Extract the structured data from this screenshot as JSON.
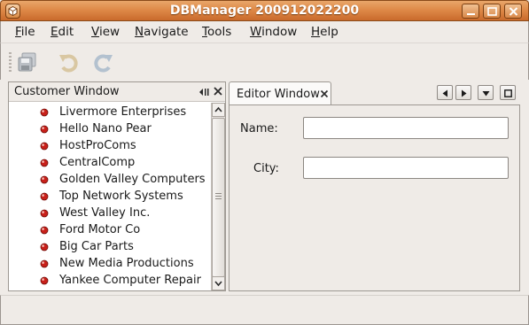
{
  "window": {
    "title": "DBManager 200912022200",
    "controls": [
      "minimize-icon",
      "maximize-icon",
      "close-icon"
    ]
  },
  "menubar": {
    "items": [
      {
        "label": "File",
        "mnemonic": "F"
      },
      {
        "label": "Edit",
        "mnemonic": "E"
      },
      {
        "label": "View",
        "mnemonic": "V"
      },
      {
        "label": "Navigate",
        "mnemonic": "N"
      },
      {
        "label": "Tools",
        "mnemonic": "T"
      },
      {
        "label": "Window",
        "mnemonic": "W"
      },
      {
        "label": "Help",
        "mnemonic": "H"
      }
    ]
  },
  "toolbar": {
    "buttons": [
      {
        "icon": "save-all-icon",
        "enabled": false
      },
      {
        "icon": "undo-icon",
        "enabled": false
      },
      {
        "icon": "redo-icon",
        "enabled": false
      }
    ]
  },
  "customer_window": {
    "title": "Customer Window",
    "customers": [
      "Livermore Enterprises",
      "Hello Nano Pear",
      "HostProComs",
      "CentralComp",
      "Golden Valley Computers",
      "Top Network Systems",
      "West Valley Inc.",
      "Ford Motor Co",
      "Big Car Parts",
      "New Media Productions",
      "Yankee Computer Repair"
    ],
    "item_icon": "customer-node-icon",
    "icon_color": "#c8201a"
  },
  "editor_window": {
    "tab_label": "Editor Window",
    "fields": [
      {
        "label": "Name:",
        "value": ""
      },
      {
        "label": "City:",
        "value": ""
      }
    ]
  },
  "colors": {
    "titlebar": "#df8a48",
    "background": "#efebe7"
  }
}
